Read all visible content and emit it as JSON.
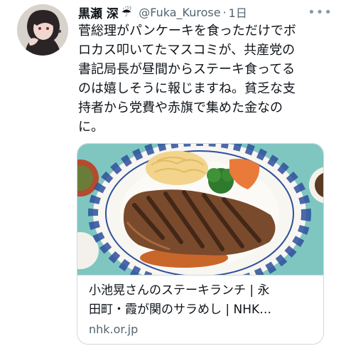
{
  "tweet": {
    "author": {
      "display_name": "黒瀬 深",
      "emoji": "☔",
      "handle": "@Fuka_Kurose",
      "separator": "·",
      "time": "1日"
    },
    "more_label": "•••",
    "text_lines": [
      "菅総理がパンケーキを食っただけでボ",
      "ロカス叩いてたマスコミが、共産党の",
      "書記局長が昼間からステーキ食ってる",
      "のは嬉しそうに報じますね。貧乏な支",
      "持者から党費や赤旗で集めた金なの",
      "に。"
    ],
    "card": {
      "title_lines": [
        "小池晃さんのステーキランチ | 永",
        "田町・霞が関のサラめし | NHK…"
      ],
      "domain": "nhk.or.jp"
    }
  },
  "colors": {
    "text": "#0f1419",
    "secondary": "#536471",
    "card_border": "#cfd9de",
    "table_teal": "#7fc6c1",
    "plate_pattern": "#2e4f9c"
  },
  "icons": {
    "more": "more-horizontal-icon",
    "umbrella": "umbrella-rain-icon"
  }
}
